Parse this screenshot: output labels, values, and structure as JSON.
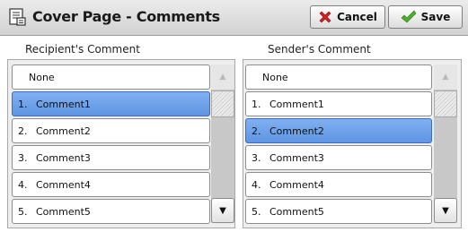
{
  "header": {
    "title": "Cover Page - Comments",
    "cancel_label": "Cancel",
    "save_label": "Save"
  },
  "left_panel": {
    "label": "Recipient's Comment",
    "none_label": "None",
    "items": [
      {
        "num": "1.",
        "text": "Comment1",
        "selected": true
      },
      {
        "num": "2.",
        "text": "Comment2",
        "selected": false
      },
      {
        "num": "3.",
        "text": "Comment3",
        "selected": false
      },
      {
        "num": "4.",
        "text": "Comment4",
        "selected": false
      },
      {
        "num": "5.",
        "text": "Comment5",
        "selected": false
      }
    ]
  },
  "right_panel": {
    "label": "Sender's Comment",
    "none_label": "None",
    "items": [
      {
        "num": "1.",
        "text": "Comment1",
        "selected": false
      },
      {
        "num": "2.",
        "text": "Comment2",
        "selected": true
      },
      {
        "num": "3.",
        "text": "Comment3",
        "selected": false
      },
      {
        "num": "4.",
        "text": "Comment4",
        "selected": false
      },
      {
        "num": "5.",
        "text": "Comment5",
        "selected": false
      }
    ]
  },
  "icons": {
    "header": "comment-page-icon",
    "cancel": "red-x-icon",
    "save": "green-check-icon",
    "scroll_up": "scroll-up-arrow-icon",
    "scroll_down": "scroll-down-arrow-icon"
  },
  "colors": {
    "selected": "#6aa0ea",
    "cancel_x": "#d42020",
    "save_check": "#4caf2a"
  }
}
